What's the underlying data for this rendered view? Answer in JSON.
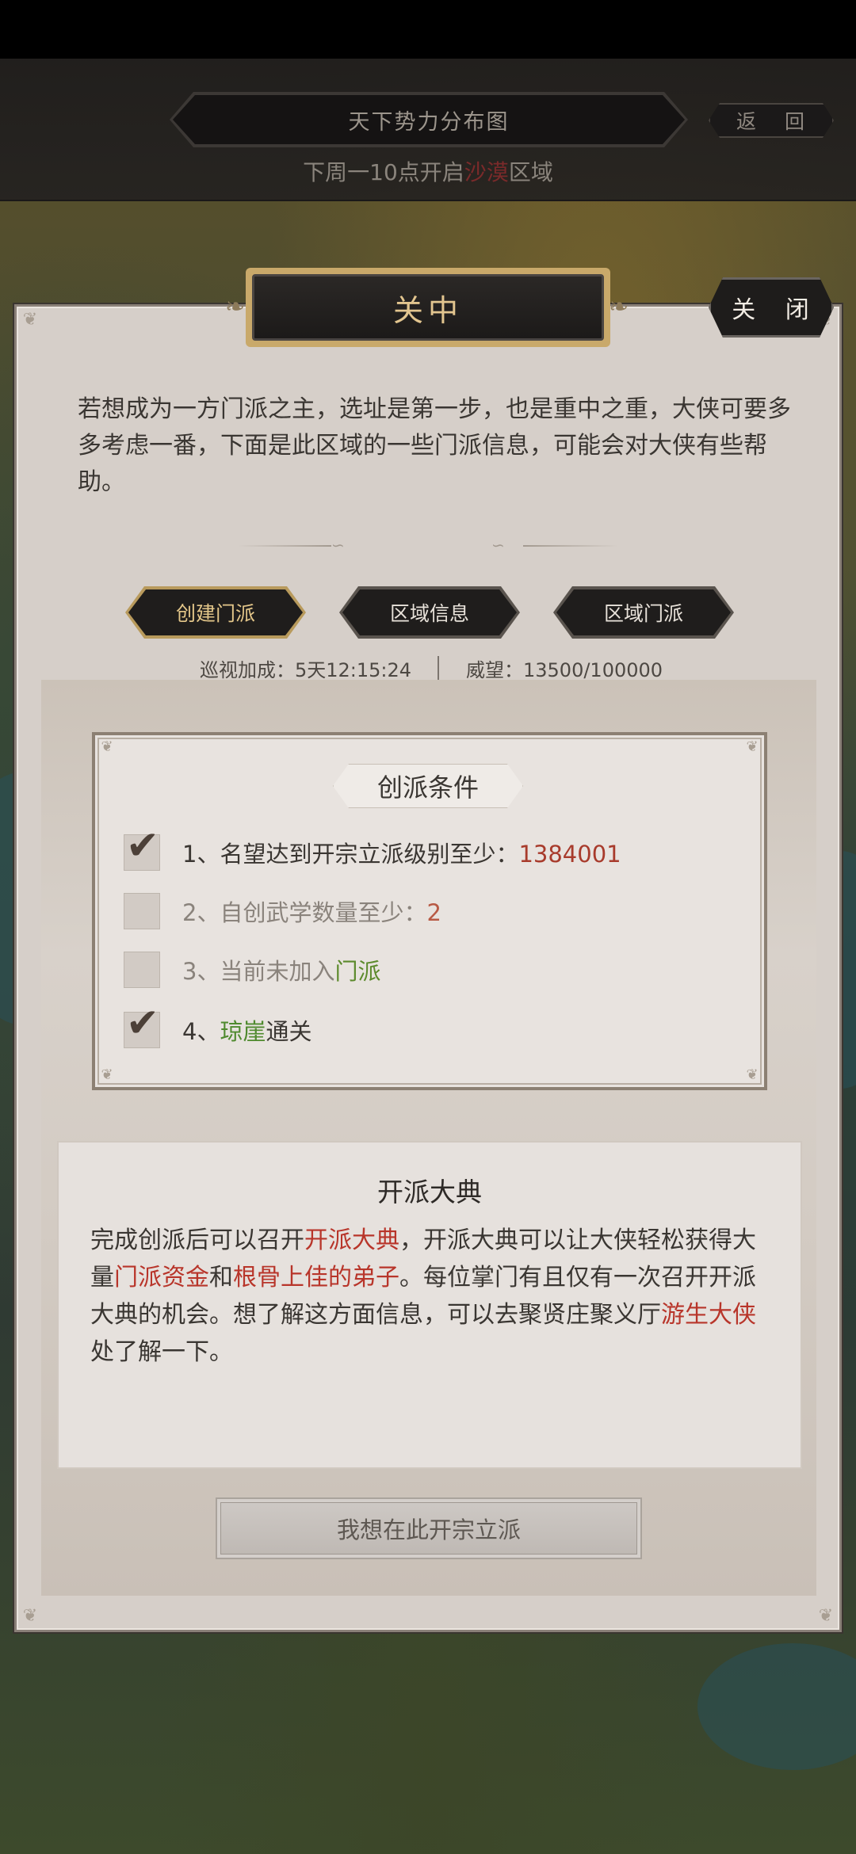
{
  "header": {
    "map_title": "天下势力分布图",
    "back_label": "返 回",
    "notice_prefix": "下周一10点开启",
    "notice_region": "沙漠",
    "notice_suffix": "区域"
  },
  "dialog": {
    "title": "关中",
    "close_label": "关 闭",
    "intro": "若想成为一方门派之主，选址是第一步，也是重中之重，大侠可要多多考虑一番，下面是此区域的一些门派信息，可能会对大侠有些帮助。",
    "tabs": [
      {
        "label": "创建门派",
        "active": true
      },
      {
        "label": "区域信息",
        "active": false
      },
      {
        "label": "区域门派",
        "active": false
      }
    ],
    "patrol_bonus": "巡视加成：5天12:15:24",
    "prestige": "威望：13500/100000"
  },
  "conditions": {
    "title": "创派条件",
    "items": [
      {
        "checked": true,
        "prefix": "1、名望达到开宗立派级别至少：",
        "value": "1384001",
        "suffix": ""
      },
      {
        "checked": false,
        "prefix": "2、自创武学数量至少：",
        "value": "2",
        "suffix": ""
      },
      {
        "checked": false,
        "prefix": "3、当前未加入",
        "value": "门派",
        "suffix": ""
      },
      {
        "checked": true,
        "prefix": "4、",
        "value": "琼崖",
        "suffix": "通关"
      }
    ]
  },
  "ceremony": {
    "title": "开派大典",
    "t1": "完成创派后可以召开",
    "h1": "开派大典",
    "t2": "，开派大典可以让大侠轻松获得大量",
    "h2": "门派资金",
    "t3": "和",
    "h3": "根骨上佳的弟子",
    "t4": "。每位掌门有且仅有一次召开开派大典的机会。想了解这方面信息，可以去聚贤庄聚义厅",
    "h4": "游生大侠",
    "t5": "处了解一下。"
  },
  "found_button": "我想在此开宗立派",
  "colors": {
    "highlight_red": "#b8352a",
    "value_red": "#a83b2c",
    "value_green": "#5c8a2c",
    "gold": "#e2c58f"
  }
}
